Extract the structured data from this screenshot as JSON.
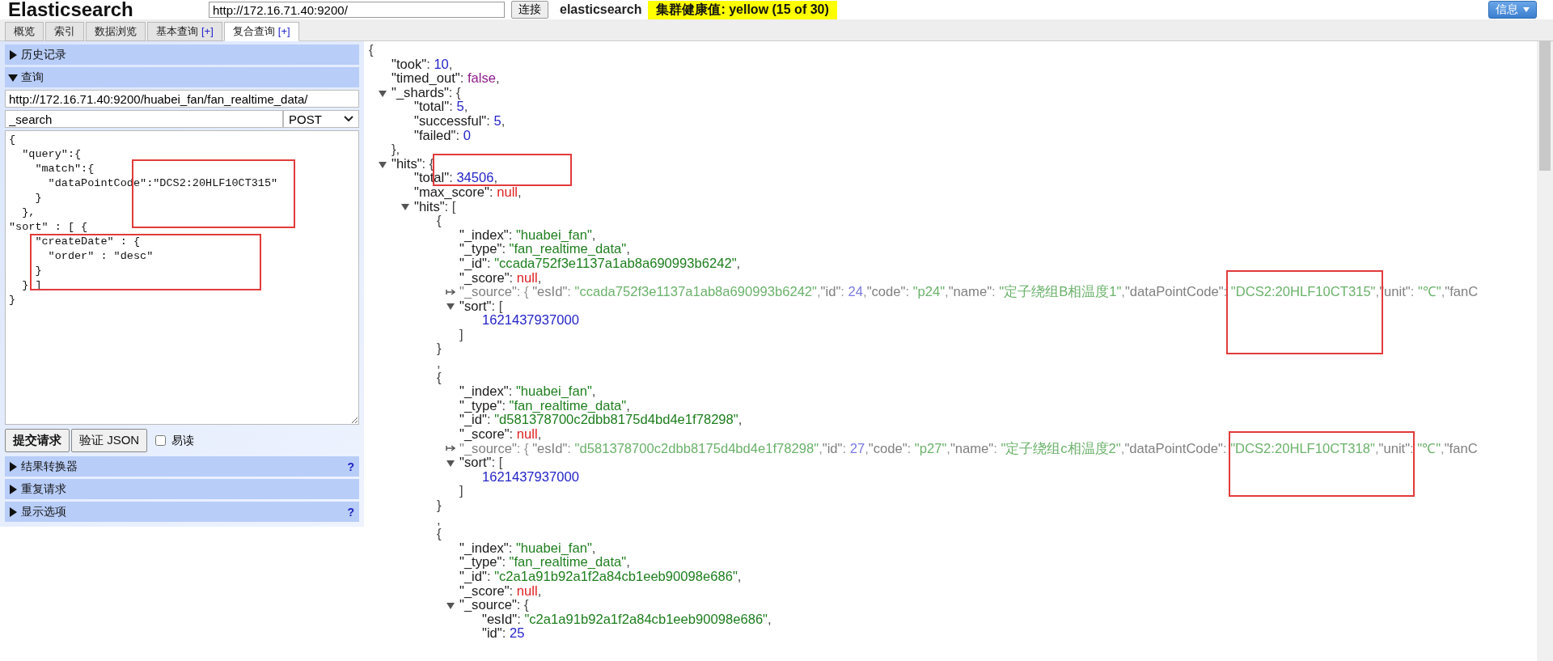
{
  "header": {
    "title": "Elasticsearch",
    "url": "http://172.16.71.40:9200/",
    "connect_button": "连接",
    "cluster_name": "elasticsearch",
    "health": "集群健康值: yellow (15 of 30)",
    "info_button": "信息"
  },
  "tabs": [
    {
      "label": "概览",
      "selected": false
    },
    {
      "label": "索引",
      "selected": false
    },
    {
      "label": "数据浏览",
      "selected": false
    },
    {
      "label": "基本查询",
      "addon": "[+]",
      "selected": false
    },
    {
      "label": "复合查询",
      "addon": "[+]",
      "selected": true
    }
  ],
  "left_panel": {
    "sections_top": [
      {
        "title": "历史记录",
        "expanded": false
      },
      {
        "title": "查询",
        "expanded": true
      }
    ],
    "query": {
      "url": "http://172.16.71.40:9200/huabei_fan/fan_realtime_data/",
      "path": "_search",
      "method": "POST",
      "body": "{\n  \"query\":{\n    \"match\":{\n      \"dataPointCode\":\"DCS2:20HLF10CT315\"\n    }\n  },\n\"sort\" : [ {\n    \"createDate\" : {\n      \"order\" : \"desc\"\n    }\n  } ]\n}"
    },
    "submit_button": "提交请求",
    "validate_button": "验证 JSON",
    "readable": {
      "label": "易读",
      "checked": false
    },
    "sections_bottom": [
      {
        "title": "结果转换器",
        "help": "?",
        "expanded": false
      },
      {
        "title": "重复请求",
        "expanded": false
      },
      {
        "title": "显示选项",
        "help": "?",
        "expanded": false
      }
    ]
  },
  "result": {
    "tokens": [
      {
        "kind": "punct",
        "text": "{"
      }
    ],
    "children": [
      {
        "tokens": [
          {
            "kind": "key",
            "text": "\"took\""
          },
          {
            "kind": "punct",
            "text": ": "
          },
          {
            "kind": "number",
            "text": "10"
          },
          {
            "kind": "punct",
            "text": ","
          }
        ]
      },
      {
        "tokens": [
          {
            "kind": "key",
            "text": "\"timed_out\""
          },
          {
            "kind": "punct",
            "text": ": "
          },
          {
            "kind": "bool",
            "text": "false"
          },
          {
            "kind": "punct",
            "text": ","
          }
        ]
      },
      {
        "expanded": true,
        "tokens": [
          {
            "kind": "key",
            "text": "\"_shards\""
          },
          {
            "kind": "punct",
            "text": ": {"
          }
        ],
        "children": [
          {
            "tokens": [
              {
                "kind": "key",
                "text": "\"total\""
              },
              {
                "kind": "punct",
                "text": ": "
              },
              {
                "kind": "number",
                "text": "5"
              },
              {
                "kind": "punct",
                "text": ","
              }
            ]
          },
          {
            "tokens": [
              {
                "kind": "key",
                "text": "\"successful\""
              },
              {
                "kind": "punct",
                "text": ": "
              },
              {
                "kind": "number",
                "text": "5"
              },
              {
                "kind": "punct",
                "text": ","
              }
            ]
          },
          {
            "tokens": [
              {
                "kind": "key",
                "text": "\"failed\""
              },
              {
                "kind": "punct",
                "text": ": "
              },
              {
                "kind": "number",
                "text": "0"
              }
            ]
          }
        ],
        "close": [
          {
            "kind": "punct",
            "text": "},"
          }
        ]
      },
      {
        "expanded": true,
        "tokens": [
          {
            "kind": "key",
            "text": "\"hits\""
          },
          {
            "kind": "punct",
            "text": ": {"
          }
        ],
        "children": [
          {
            "tokens": [
              {
                "kind": "key",
                "text": "\"total\""
              },
              {
                "kind": "punct",
                "text": ": "
              },
              {
                "kind": "number",
                "text": "34506"
              },
              {
                "kind": "punct",
                "text": ","
              }
            ]
          },
          {
            "tokens": [
              {
                "kind": "key",
                "text": "\"max_score\""
              },
              {
                "kind": "punct",
                "text": ": "
              },
              {
                "kind": "null",
                "text": "null"
              },
              {
                "kind": "punct",
                "text": ","
              }
            ]
          },
          {
            "expanded": true,
            "tokens": [
              {
                "kind": "key",
                "text": "\"hits\""
              },
              {
                "kind": "punct",
                "text": ": ["
              }
            ],
            "children": [
              {
                "tokens": [
                  {
                    "kind": "punct",
                    "text": "{"
                  }
                ],
                "children": [
                  {
                    "tokens": [
                      {
                        "kind": "key",
                        "text": "\"_index\""
                      },
                      {
                        "kind": "punct",
                        "text": ": "
                      },
                      {
                        "kind": "string",
                        "text": "\"huabei_fan\""
                      },
                      {
                        "kind": "punct",
                        "text": ","
                      }
                    ]
                  },
                  {
                    "tokens": [
                      {
                        "kind": "key",
                        "text": "\"_type\""
                      },
                      {
                        "kind": "punct",
                        "text": ": "
                      },
                      {
                        "kind": "string",
                        "text": "\"fan_realtime_data\""
                      },
                      {
                        "kind": "punct",
                        "text": ","
                      }
                    ]
                  },
                  {
                    "tokens": [
                      {
                        "kind": "key",
                        "text": "\"_id\""
                      },
                      {
                        "kind": "punct",
                        "text": ": "
                      },
                      {
                        "kind": "string",
                        "text": "\"ccada752f3e1137a1ab8a690993b6242\""
                      },
                      {
                        "kind": "punct",
                        "text": ","
                      }
                    ]
                  },
                  {
                    "tokens": [
                      {
                        "kind": "key",
                        "text": "\"_score\""
                      },
                      {
                        "kind": "punct",
                        "text": ": "
                      },
                      {
                        "kind": "null",
                        "text": "null"
                      },
                      {
                        "kind": "punct",
                        "text": ","
                      }
                    ]
                  },
                  {
                    "expanded": false,
                    "tokens": [
                      {
                        "kind": "key",
                        "text": "\"_source\""
                      },
                      {
                        "kind": "punct",
                        "text": ": { "
                      },
                      {
                        "kind": "key",
                        "text": "\"esId\""
                      },
                      {
                        "kind": "punct",
                        "text": ": "
                      },
                      {
                        "kind": "string",
                        "text": "\"ccada752f3e1137a1ab8a690993b6242\""
                      },
                      {
                        "kind": "punct",
                        "text": ","
                      },
                      {
                        "kind": "key",
                        "text": "\"id\""
                      },
                      {
                        "kind": "punct",
                        "text": ": "
                      },
                      {
                        "kind": "number",
                        "text": "24"
                      },
                      {
                        "kind": "punct",
                        "text": ","
                      },
                      {
                        "kind": "key",
                        "text": "\"code\""
                      },
                      {
                        "kind": "punct",
                        "text": ": "
                      },
                      {
                        "kind": "string",
                        "text": "\"p24\""
                      },
                      {
                        "kind": "punct",
                        "text": ","
                      },
                      {
                        "kind": "key",
                        "text": "\"name\""
                      },
                      {
                        "kind": "punct",
                        "text": ": "
                      },
                      {
                        "kind": "string",
                        "text": "\"定子绕组B相温度1\""
                      },
                      {
                        "kind": "punct",
                        "text": ","
                      },
                      {
                        "kind": "key",
                        "text": "\"dataPointCode\""
                      },
                      {
                        "kind": "punct",
                        "text": ": "
                      },
                      {
                        "kind": "string",
                        "text": "\"DCS2:20HLF10CT315\""
                      },
                      {
                        "kind": "punct",
                        "text": ","
                      },
                      {
                        "kind": "key",
                        "text": "\"unit\""
                      },
                      {
                        "kind": "punct",
                        "text": ": "
                      },
                      {
                        "kind": "string",
                        "text": "\"℃\""
                      },
                      {
                        "kind": "punct",
                        "text": ","
                      },
                      {
                        "kind": "key",
                        "text": "\"fanC"
                      }
                    ]
                  },
                  {
                    "expanded": true,
                    "tokens": [
                      {
                        "kind": "key",
                        "text": "\"sort\""
                      },
                      {
                        "kind": "punct",
                        "text": ": ["
                      }
                    ],
                    "children": [
                      {
                        "tokens": [
                          {
                            "kind": "number",
                            "text": "1621437937000"
                          }
                        ]
                      }
                    ],
                    "close": [
                      {
                        "kind": "punct",
                        "text": "]"
                      }
                    ]
                  }
                ],
                "close": [
                  {
                    "kind": "punct",
                    "text": "}"
                  }
                ]
              },
              {
                "tokens": [
                  {
                    "kind": "punct",
                    "text": ","
                  }
                ]
              },
              {
                "tokens": [
                  {
                    "kind": "punct",
                    "text": "{"
                  }
                ],
                "children": [
                  {
                    "tokens": [
                      {
                        "kind": "key",
                        "text": "\"_index\""
                      },
                      {
                        "kind": "punct",
                        "text": ": "
                      },
                      {
                        "kind": "string",
                        "text": "\"huabei_fan\""
                      },
                      {
                        "kind": "punct",
                        "text": ","
                      }
                    ]
                  },
                  {
                    "tokens": [
                      {
                        "kind": "key",
                        "text": "\"_type\""
                      },
                      {
                        "kind": "punct",
                        "text": ": "
                      },
                      {
                        "kind": "string",
                        "text": "\"fan_realtime_data\""
                      },
                      {
                        "kind": "punct",
                        "text": ","
                      }
                    ]
                  },
                  {
                    "tokens": [
                      {
                        "kind": "key",
                        "text": "\"_id\""
                      },
                      {
                        "kind": "punct",
                        "text": ": "
                      },
                      {
                        "kind": "string",
                        "text": "\"d581378700c2dbb8175d4bd4e1f78298\""
                      },
                      {
                        "kind": "punct",
                        "text": ","
                      }
                    ]
                  },
                  {
                    "tokens": [
                      {
                        "kind": "key",
                        "text": "\"_score\""
                      },
                      {
                        "kind": "punct",
                        "text": ": "
                      },
                      {
                        "kind": "null",
                        "text": "null"
                      },
                      {
                        "kind": "punct",
                        "text": ","
                      }
                    ]
                  },
                  {
                    "expanded": false,
                    "tokens": [
                      {
                        "kind": "key",
                        "text": "\"_source\""
                      },
                      {
                        "kind": "punct",
                        "text": ": { "
                      },
                      {
                        "kind": "key",
                        "text": "\"esId\""
                      },
                      {
                        "kind": "punct",
                        "text": ": "
                      },
                      {
                        "kind": "string",
                        "text": "\"d581378700c2dbb8175d4bd4e1f78298\""
                      },
                      {
                        "kind": "punct",
                        "text": ","
                      },
                      {
                        "kind": "key",
                        "text": "\"id\""
                      },
                      {
                        "kind": "punct",
                        "text": ": "
                      },
                      {
                        "kind": "number",
                        "text": "27"
                      },
                      {
                        "kind": "punct",
                        "text": ","
                      },
                      {
                        "kind": "key",
                        "text": "\"code\""
                      },
                      {
                        "kind": "punct",
                        "text": ": "
                      },
                      {
                        "kind": "string",
                        "text": "\"p27\""
                      },
                      {
                        "kind": "punct",
                        "text": ","
                      },
                      {
                        "kind": "key",
                        "text": "\"name\""
                      },
                      {
                        "kind": "punct",
                        "text": ": "
                      },
                      {
                        "kind": "string",
                        "text": "\"定子绕组c相温度2\""
                      },
                      {
                        "kind": "punct",
                        "text": ","
                      },
                      {
                        "kind": "key",
                        "text": "\"dataPointCode\""
                      },
                      {
                        "kind": "punct",
                        "text": ": "
                      },
                      {
                        "kind": "string",
                        "text": "\"DCS2:20HLF10CT318\""
                      },
                      {
                        "kind": "punct",
                        "text": ","
                      },
                      {
                        "kind": "key",
                        "text": "\"unit\""
                      },
                      {
                        "kind": "punct",
                        "text": ": "
                      },
                      {
                        "kind": "string",
                        "text": "\"℃\""
                      },
                      {
                        "kind": "punct",
                        "text": ","
                      },
                      {
                        "kind": "key",
                        "text": "\"fanC"
                      }
                    ]
                  },
                  {
                    "expanded": true,
                    "tokens": [
                      {
                        "kind": "key",
                        "text": "\"sort\""
                      },
                      {
                        "kind": "punct",
                        "text": ": ["
                      }
                    ],
                    "children": [
                      {
                        "tokens": [
                          {
                            "kind": "number",
                            "text": "1621437937000"
                          }
                        ]
                      }
                    ],
                    "close": [
                      {
                        "kind": "punct",
                        "text": "]"
                      }
                    ]
                  }
                ],
                "close": [
                  {
                    "kind": "punct",
                    "text": "}"
                  }
                ]
              },
              {
                "tokens": [
                  {
                    "kind": "punct",
                    "text": ","
                  }
                ]
              },
              {
                "tokens": [
                  {
                    "kind": "punct",
                    "text": "{"
                  }
                ],
                "children": [
                  {
                    "tokens": [
                      {
                        "kind": "key",
                        "text": "\"_index\""
                      },
                      {
                        "kind": "punct",
                        "text": ": "
                      },
                      {
                        "kind": "string",
                        "text": "\"huabei_fan\""
                      },
                      {
                        "kind": "punct",
                        "text": ","
                      }
                    ]
                  },
                  {
                    "tokens": [
                      {
                        "kind": "key",
                        "text": "\"_type\""
                      },
                      {
                        "kind": "punct",
                        "text": ": "
                      },
                      {
                        "kind": "string",
                        "text": "\"fan_realtime_data\""
                      },
                      {
                        "kind": "punct",
                        "text": ","
                      }
                    ]
                  },
                  {
                    "tokens": [
                      {
                        "kind": "key",
                        "text": "\"_id\""
                      },
                      {
                        "kind": "punct",
                        "text": ": "
                      },
                      {
                        "kind": "string",
                        "text": "\"c2a1a91b92a1f2a84cb1eeb90098e686\""
                      },
                      {
                        "kind": "punct",
                        "text": ","
                      }
                    ]
                  },
                  {
                    "tokens": [
                      {
                        "kind": "key",
                        "text": "\"_score\""
                      },
                      {
                        "kind": "punct",
                        "text": ": "
                      },
                      {
                        "kind": "null",
                        "text": "null"
                      },
                      {
                        "kind": "punct",
                        "text": ","
                      }
                    ]
                  },
                  {
                    "expanded": true,
                    "tokens": [
                      {
                        "kind": "key",
                        "text": "\"_source\""
                      },
                      {
                        "kind": "punct",
                        "text": ": {"
                      }
                    ],
                    "children": [
                      {
                        "tokens": [
                          {
                            "kind": "key",
                            "text": "\"esId\""
                          },
                          {
                            "kind": "punct",
                            "text": ": "
                          },
                          {
                            "kind": "string",
                            "text": "\"c2a1a91b92a1f2a84cb1eeb90098e686\""
                          },
                          {
                            "kind": "punct",
                            "text": ","
                          }
                        ]
                      },
                      {
                        "tokens": [
                          {
                            "kind": "key",
                            "text": "\"id\""
                          },
                          {
                            "kind": "punct",
                            "text": ": "
                          },
                          {
                            "kind": "number",
                            "text": "25"
                          }
                        ]
                      }
                    ]
                  }
                ]
              }
            ]
          }
        ]
      }
    ]
  }
}
